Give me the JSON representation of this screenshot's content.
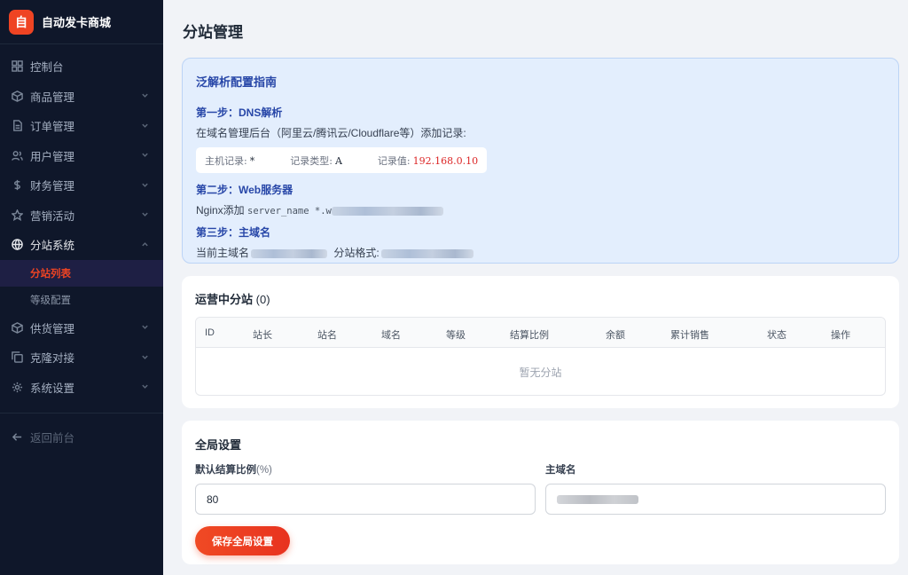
{
  "brand": {
    "logo_char": "自",
    "name": "自动发卡商城",
    "accent": "#ef4423"
  },
  "sidebar": {
    "items": [
      {
        "label": "控制台",
        "icon": "dashboard-icon",
        "has_chevron": false
      },
      {
        "label": "商品管理",
        "icon": "cube-icon",
        "has_chevron": true
      },
      {
        "label": "订单管理",
        "icon": "document-icon",
        "has_chevron": true
      },
      {
        "label": "用户管理",
        "icon": "users-icon",
        "has_chevron": true
      },
      {
        "label": "财务管理",
        "icon": "dollar-icon",
        "has_chevron": true
      },
      {
        "label": "营销活动",
        "icon": "star-icon",
        "has_chevron": true
      },
      {
        "label": "分站系统",
        "icon": "globe-icon",
        "has_chevron": true,
        "open": true
      },
      {
        "label": "供货管理",
        "icon": "box-icon",
        "has_chevron": true
      },
      {
        "label": "克隆对接",
        "icon": "copy-icon",
        "has_chevron": true
      },
      {
        "label": "系统设置",
        "icon": "gear-icon",
        "has_chevron": true
      }
    ],
    "sub_items": [
      {
        "label": "分站列表",
        "active": true
      },
      {
        "label": "等级配置",
        "active": false
      }
    ],
    "back_label": "返回前台"
  },
  "page": {
    "title": "分站管理"
  },
  "guide": {
    "title": "泛解析配置指南",
    "step1_title": "第一步：DNS解析",
    "step1_text": "在域名管理后台（阿里云/腾讯云/Cloudflare等）添加记录:",
    "record_host_label": "主机记录:",
    "record_host_value": "*",
    "record_type_label": "记录类型:",
    "record_type_value": "A",
    "record_value_label": "记录值:",
    "record_value_value": "192.168.0.10",
    "step2_title": "第二步：Web服务器",
    "step2_prefix": "Nginx添加",
    "step2_code": "server_name *.w",
    "step3_title": "第三步：主域名",
    "step3_prefix": "当前主域名",
    "step3_mid": "分站格式:"
  },
  "substations": {
    "title": "运营中分站",
    "count": "(0)",
    "columns": [
      "ID",
      "站长",
      "站名",
      "域名",
      "等级",
      "结算比例",
      "余额",
      "累计销售",
      "状态",
      "操作"
    ],
    "empty_text": "暂无分站"
  },
  "global_settings": {
    "title": "全局设置",
    "ratio_label": "默认结算比例",
    "ratio_unit": "(%)",
    "ratio_value": "80",
    "domain_label": "主域名",
    "save_label": "保存全局设置"
  }
}
